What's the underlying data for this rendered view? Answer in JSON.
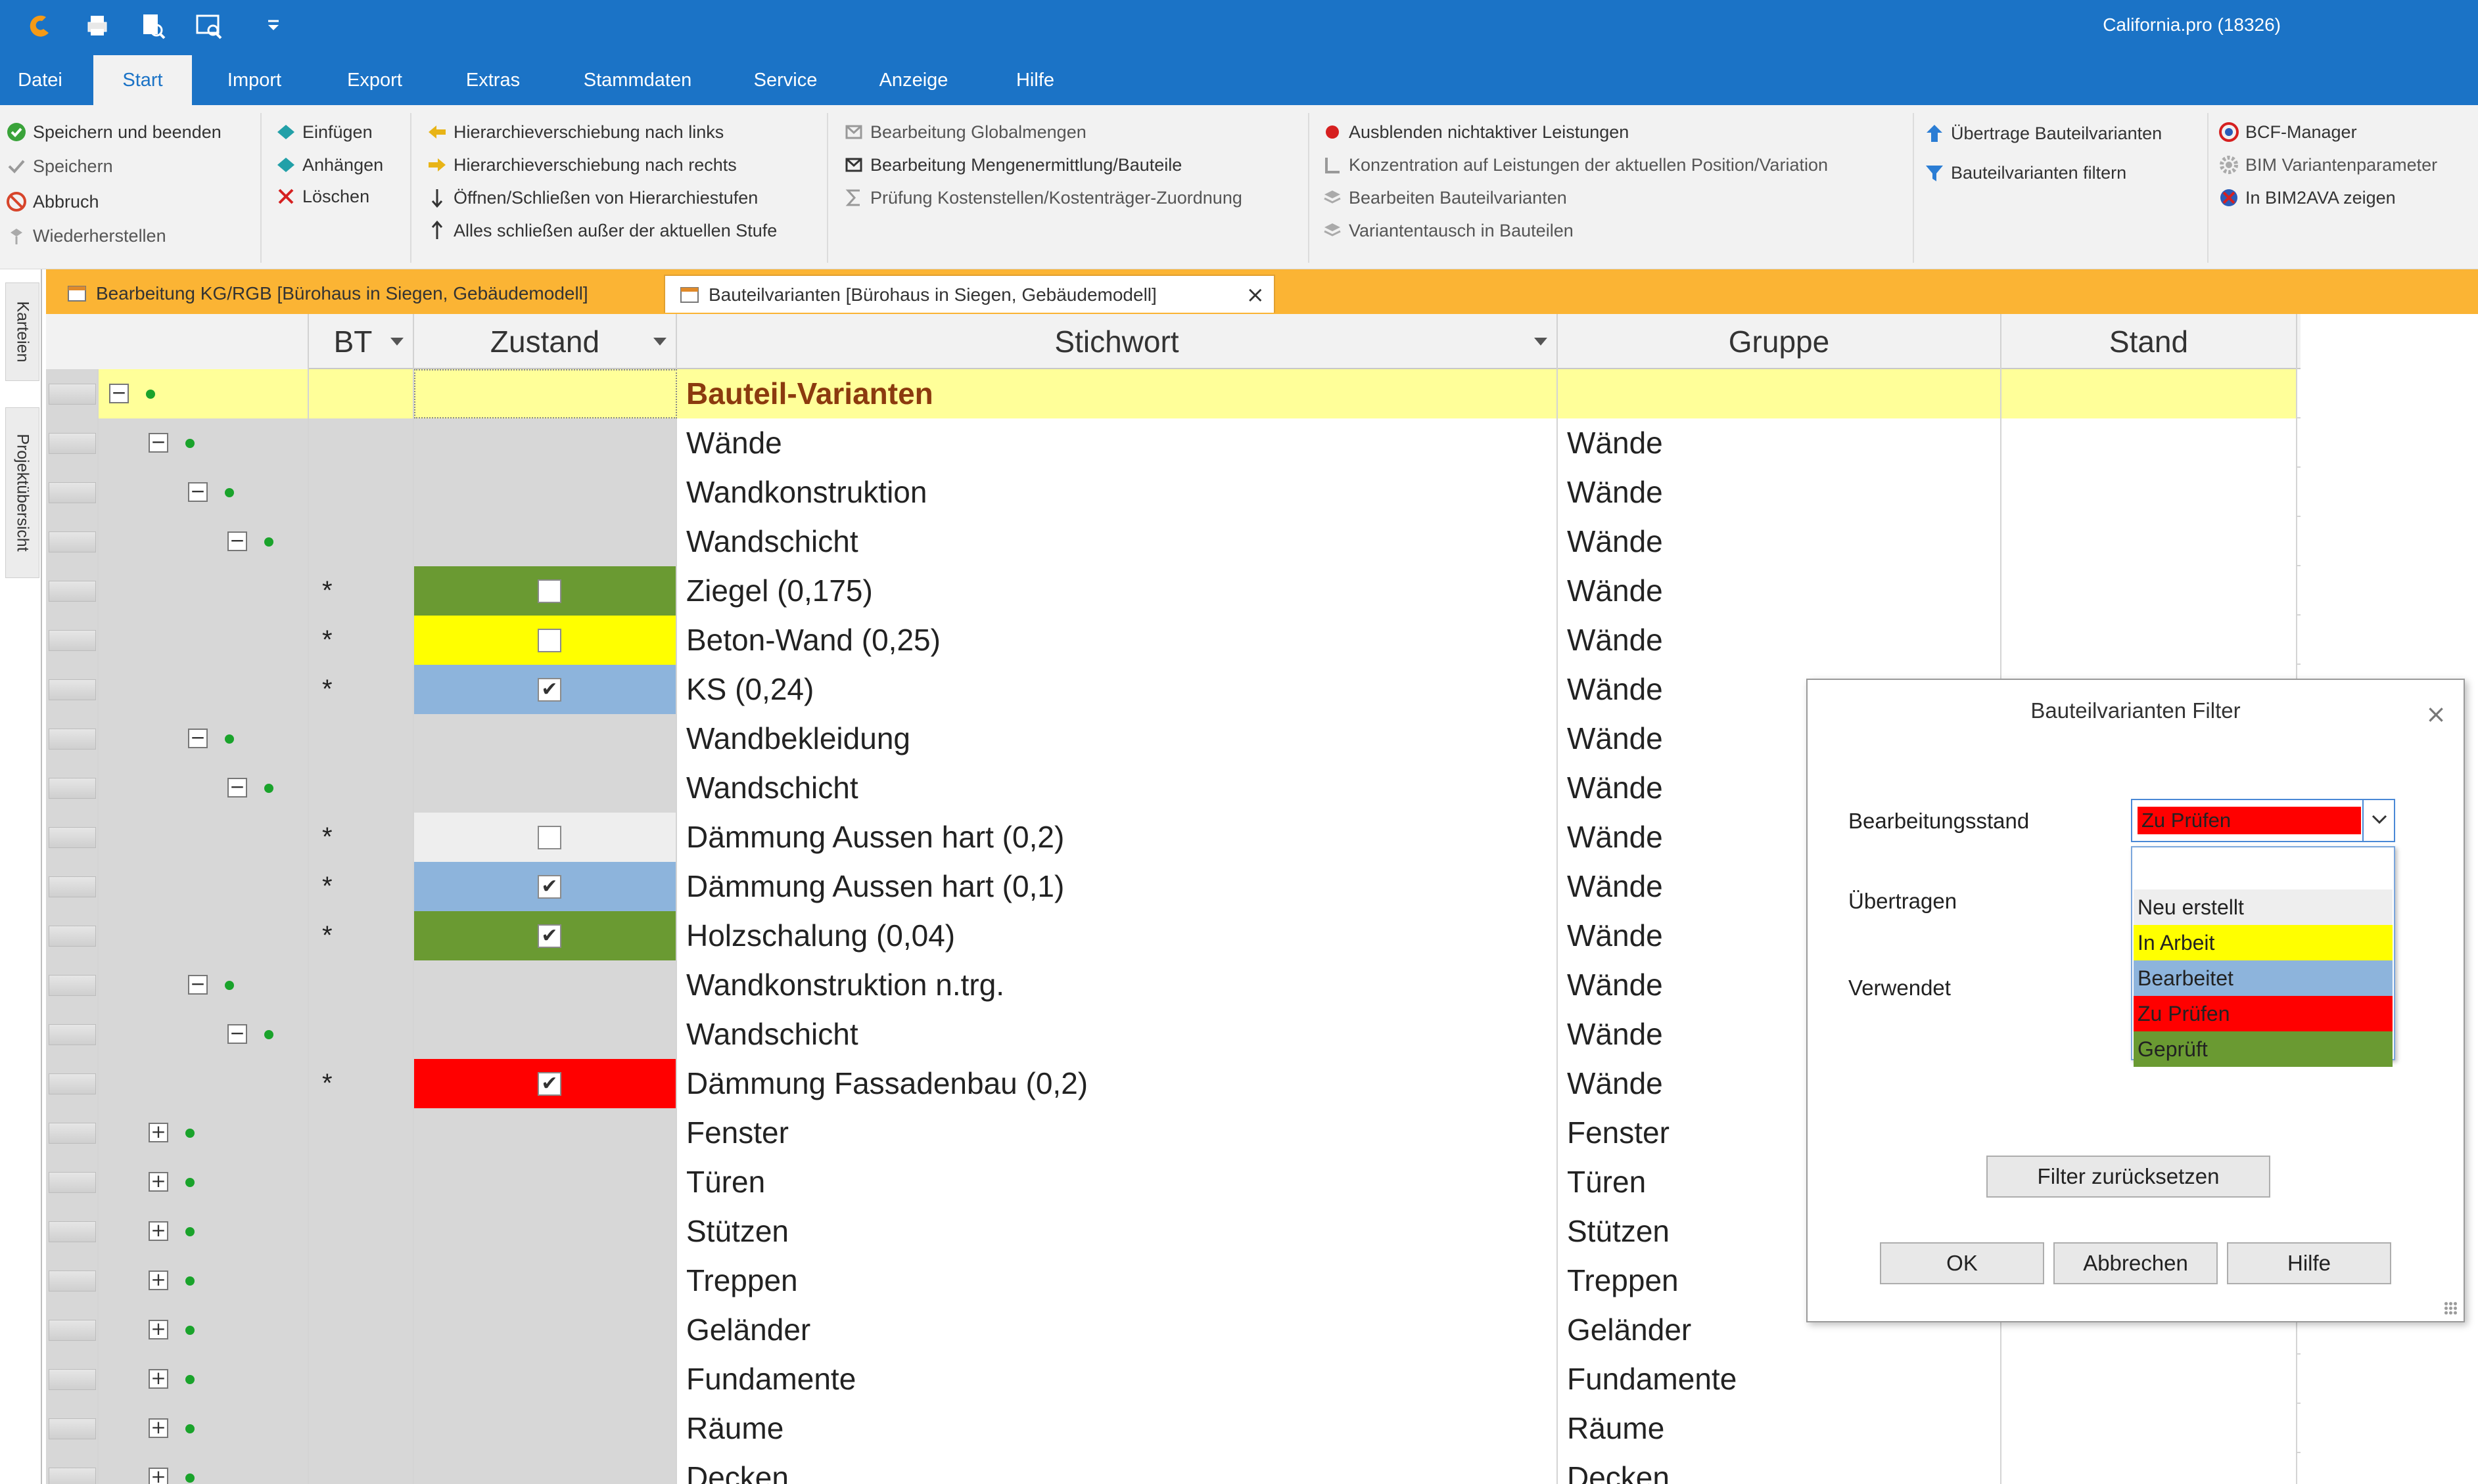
{
  "app": {
    "title": "California.pro (18326)"
  },
  "menu": {
    "tabs": [
      "Datei",
      "Start",
      "Import",
      "Export",
      "Extras",
      "Stammdaten",
      "Service",
      "Anzeige",
      "Hilfe"
    ],
    "active": "Start"
  },
  "ribbon": {
    "g1": [
      "Speichern und beenden",
      "Speichern",
      "Abbruch",
      "Wiederherstellen"
    ],
    "g2": [
      "Einfügen",
      "Anhängen",
      "Löschen"
    ],
    "g3": [
      "Hierarchieverschiebung nach links",
      "Hierarchieverschiebung nach rechts",
      "Öffnen/Schließen von Hierarchiestufen",
      "Alles schließen außer der aktuellen Stufe"
    ],
    "g4": [
      "Bearbeitung Globalmengen",
      "Bearbeitung Mengenermittlung/Bauteile",
      "Prüfung Kostenstellen/Kostenträger-Zuordnung"
    ],
    "g5": [
      "Ausblenden nichtaktiver Leistungen",
      "Konzentration auf Leistungen der aktuellen Position/Variation",
      "Bearbeiten Bauteilvarianten",
      "Variantentausch in Bauteilen"
    ],
    "g6": [
      "Übertrage Bauteilvarianten",
      "Bauteilvarianten filtern"
    ],
    "g7": [
      "BCF-Manager",
      "BIM Variantenparameter",
      "In BIM2AVA zeigen"
    ]
  },
  "doc_tabs": {
    "tab1": "Bearbeitung KG/RGB [Bürohaus in Siegen, Gebäudemodell]",
    "tab2": "Bauteilvarianten [Bürohaus in Siegen, Gebäudemodell]",
    "close": "×"
  },
  "side_tabs": {
    "karteien": "Karteien",
    "projekt": "Projektübersicht"
  },
  "grid": {
    "headers": {
      "bt": "BT",
      "zustand": "Zustand",
      "stichwort": "Stichwort",
      "gruppe": "Gruppe",
      "stand": "Stand"
    },
    "rows": [
      {
        "level": 0,
        "toggle": "−",
        "bt": "",
        "state": "",
        "checked": null,
        "stichwort": "Bauteil-Varianten",
        "gruppe": ""
      },
      {
        "level": 1,
        "toggle": "−",
        "bt": "",
        "state": "",
        "checked": null,
        "stichwort": "Wände",
        "gruppe": "Wände"
      },
      {
        "level": 2,
        "toggle": "−",
        "bt": "",
        "state": "",
        "checked": null,
        "stichwort": "Wandkonstruktion",
        "gruppe": "Wände"
      },
      {
        "level": 3,
        "toggle": "−",
        "bt": "",
        "state": "",
        "checked": null,
        "stichwort": "Wandschicht",
        "gruppe": "Wände"
      },
      {
        "level": 4,
        "toggle": "",
        "bt": "*",
        "state": "Geprüft",
        "checked": false,
        "stichwort": "Ziegel (0,175)",
        "gruppe": "Wände"
      },
      {
        "level": 4,
        "toggle": "",
        "bt": "*",
        "state": "In Arbeit",
        "checked": false,
        "stichwort": "Beton-Wand (0,25)",
        "gruppe": "Wände"
      },
      {
        "level": 4,
        "toggle": "",
        "bt": "*",
        "state": "Bearbeitet",
        "checked": true,
        "stichwort": "KS (0,24)",
        "gruppe": "Wände"
      },
      {
        "level": 2,
        "toggle": "−",
        "bt": "",
        "state": "",
        "checked": null,
        "stichwort": "Wandbekleidung",
        "gruppe": "Wände"
      },
      {
        "level": 3,
        "toggle": "−",
        "bt": "",
        "state": "",
        "checked": null,
        "stichwort": "Wandschicht",
        "gruppe": "Wände"
      },
      {
        "level": 4,
        "toggle": "",
        "bt": "*",
        "state": "Neu erstellt",
        "checked": false,
        "stichwort": "Dämmung Aussen hart (0,2)",
        "gruppe": "Wände"
      },
      {
        "level": 4,
        "toggle": "",
        "bt": "*",
        "state": "Bearbeitet",
        "checked": true,
        "stichwort": "Dämmung Aussen hart (0,1)",
        "gruppe": "Wände"
      },
      {
        "level": 4,
        "toggle": "",
        "bt": "*",
        "state": "Geprüft",
        "checked": true,
        "stichwort": "Holzschalung (0,04)",
        "gruppe": "Wände"
      },
      {
        "level": 2,
        "toggle": "−",
        "bt": "",
        "state": "",
        "checked": null,
        "stichwort": "Wandkonstruktion n.trg.",
        "gruppe": "Wände"
      },
      {
        "level": 3,
        "toggle": "−",
        "bt": "",
        "state": "",
        "checked": null,
        "stichwort": "Wandschicht",
        "gruppe": "Wände"
      },
      {
        "level": 4,
        "toggle": "",
        "bt": "*",
        "state": "Zu Prüfen",
        "checked": true,
        "stichwort": "Dämmung Fassadenbau (0,2)",
        "gruppe": "Wände"
      },
      {
        "level": 1,
        "toggle": "+",
        "bt": "",
        "state": "",
        "checked": null,
        "stichwort": "Fenster",
        "gruppe": "Fenster"
      },
      {
        "level": 1,
        "toggle": "+",
        "bt": "",
        "state": "",
        "checked": null,
        "stichwort": "Türen",
        "gruppe": "Türen"
      },
      {
        "level": 1,
        "toggle": "+",
        "bt": "",
        "state": "",
        "checked": null,
        "stichwort": "Stützen",
        "gruppe": "Stützen"
      },
      {
        "level": 1,
        "toggle": "+",
        "bt": "",
        "state": "",
        "checked": null,
        "stichwort": "Treppen",
        "gruppe": "Treppen"
      },
      {
        "level": 1,
        "toggle": "+",
        "bt": "",
        "state": "",
        "checked": null,
        "stichwort": "Geländer",
        "gruppe": "Geländer"
      },
      {
        "level": 1,
        "toggle": "+",
        "bt": "",
        "state": "",
        "checked": null,
        "stichwort": "Fundamente",
        "gruppe": "Fundamente"
      },
      {
        "level": 1,
        "toggle": "+",
        "bt": "",
        "state": "",
        "checked": null,
        "stichwort": "Räume",
        "gruppe": "Räume"
      },
      {
        "level": 1,
        "toggle": "+",
        "bt": "",
        "state": "",
        "checked": null,
        "stichwort": "Decken",
        "gruppe": "Decken"
      }
    ]
  },
  "state_colors": {
    "Neu erstellt": "#eeeeee",
    "In Arbeit": "#ffff00",
    "Bearbeitet": "#8db4dc",
    "Zu Prüfen": "#ff0000",
    "Geprüft": "#6a9a32"
  },
  "dialog": {
    "title": "Bauteilvarianten Filter",
    "close": "×",
    "label_stand": "Bearbeitungsstand",
    "label_uebertragen": "Übertragen",
    "label_verwendet": "Verwendet",
    "combo_value": "Zu Prüfen",
    "options": [
      "Neu erstellt",
      "In Arbeit",
      "Bearbeitet",
      "Zu Prüfen",
      "Geprüft"
    ],
    "reset": "Filter zurücksetzen",
    "ok": "OK",
    "cancel": "Abbrechen",
    "help": "Hilfe"
  }
}
